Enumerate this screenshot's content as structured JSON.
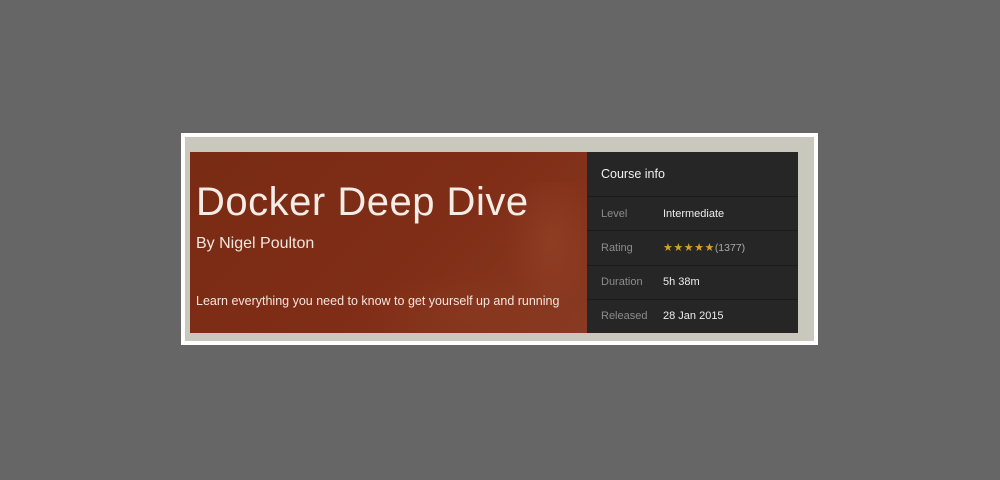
{
  "course": {
    "title": "Docker Deep Dive",
    "author": "By Nigel Poulton",
    "description": "Learn everything you need to know to get yourself up and running"
  },
  "info": {
    "heading": "Course info",
    "level": {
      "label": "Level",
      "value": "Intermediate"
    },
    "rating": {
      "label": "Rating",
      "stars": "★★★★★",
      "count": "(1377)",
      "star_color": "#d4a12a"
    },
    "duration": {
      "label": "Duration",
      "value": "5h 38m"
    },
    "released": {
      "label": "Released",
      "value": "28 Jan 2015"
    }
  },
  "colors": {
    "hero_bg": "#7f2d16",
    "panel_bg": "#262626",
    "page_bg": "#666666"
  }
}
